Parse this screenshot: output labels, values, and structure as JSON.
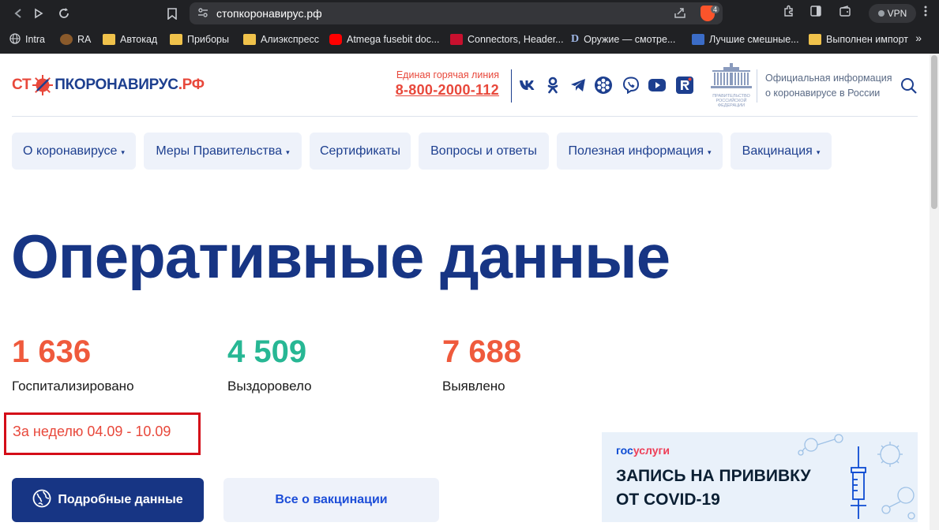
{
  "browser": {
    "url": "стопкоронавирус.рф",
    "vpn_label": "VPN",
    "extension_badge": "4",
    "bookmarks": [
      {
        "label": "Intra"
      },
      {
        "label": "RA"
      },
      {
        "label": "Автокад"
      },
      {
        "label": "Приборы"
      },
      {
        "label": "Алиэкспресс"
      },
      {
        "label": "Atmega fusebit doc..."
      },
      {
        "label": "Connectors, Header..."
      },
      {
        "label": "Оружие — смотре..."
      },
      {
        "label": "Лучшие смешные..."
      },
      {
        "label": "Выполнен импорт"
      }
    ],
    "more_label": "»"
  },
  "header": {
    "logo_part1": "СТ",
    "logo_part2": "ПКОРОНАВИРУС",
    "logo_part3": ".РФ",
    "hotline_label": "Единая горячая линия",
    "hotline_phone": "8-800-2000-112",
    "official_line1": "Официальная информация",
    "official_line2": "о коронавирусе в России",
    "gov_caption": "ПРАВИТЕЛЬСТВО РОССИЙСКОЙ ФЕДЕРАЦИИ"
  },
  "nav": {
    "items": [
      {
        "label": "О коронавирусе",
        "caret": "▾"
      },
      {
        "label": "Меры Правительства",
        "caret": "▾"
      },
      {
        "label": "Сертификаты",
        "caret": ""
      },
      {
        "label": "Вопросы и ответы",
        "caret": ""
      },
      {
        "label": "Полезная информация",
        "caret": "▾"
      },
      {
        "label": "Вакцинация",
        "caret": "▾"
      }
    ]
  },
  "main": {
    "title": "Оперативные данные",
    "stats": [
      {
        "value": "1 636",
        "label": "Госпитализировано",
        "color": "#ef5a3c"
      },
      {
        "value": "4 509",
        "label": "Выздоровело",
        "color": "#27b794"
      },
      {
        "value": "7 688",
        "label": "Выявлено",
        "color": "#ef5a3c"
      }
    ],
    "period": "За неделю 04.09 - 10.09",
    "details_button": "Подробные данные",
    "vaccination_button": "Все о вакцинации"
  },
  "banner": {
    "brand_part1": "гос",
    "brand_part2": "услуги",
    "line1": "ЗАПИСЬ НА ПРИВИВКУ",
    "line2": "ОТ COVID-19"
  },
  "colors": {
    "brand_blue": "#173584",
    "accent_red": "#e8483b",
    "recovered_green": "#27b794",
    "highlight_border": "#d40d18"
  }
}
